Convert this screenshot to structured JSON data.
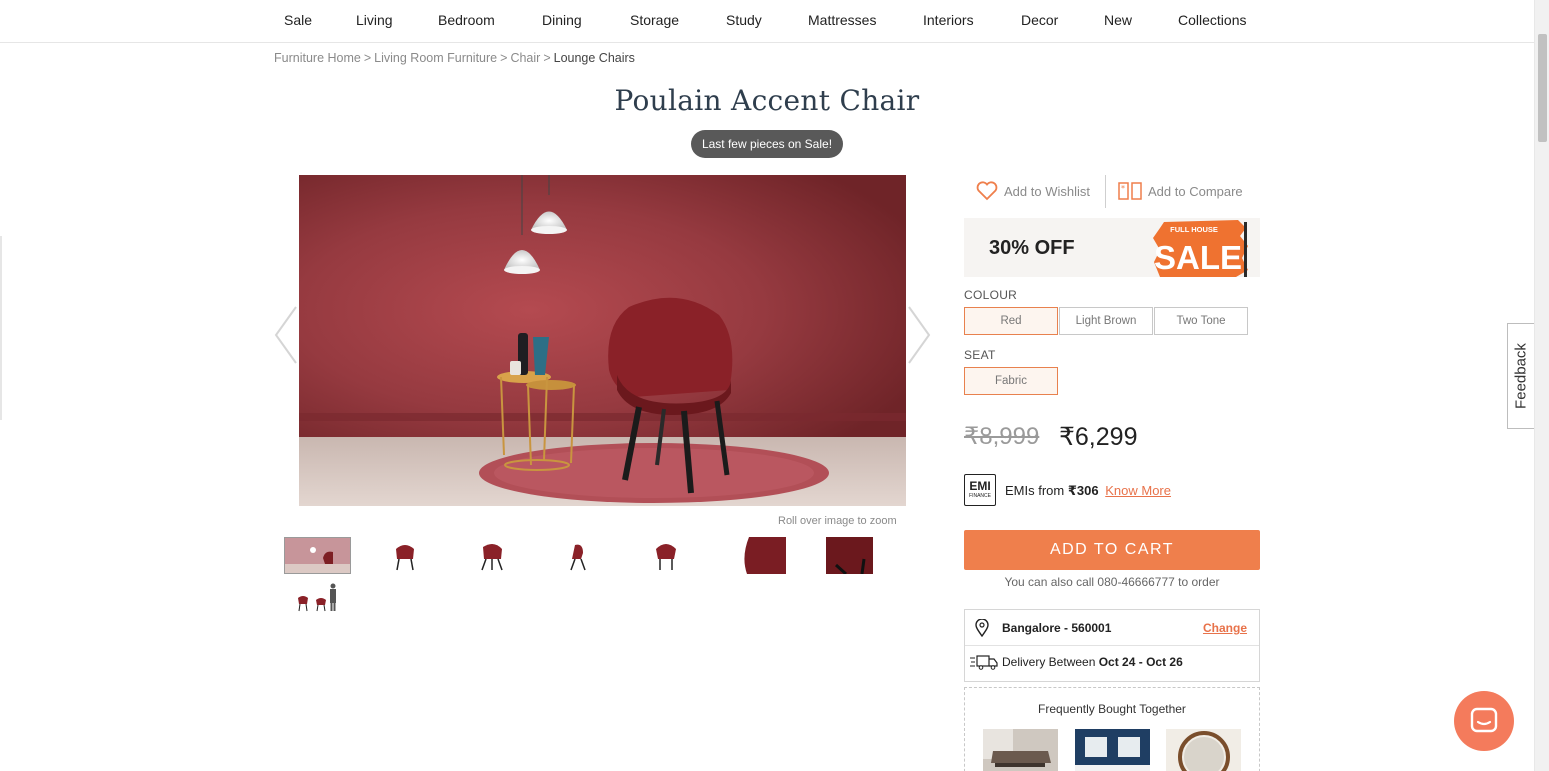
{
  "nav": {
    "items": [
      "Sale",
      "Living",
      "Bedroom",
      "Dining",
      "Storage",
      "Study",
      "Mattresses",
      "Interiors",
      "Decor",
      "New",
      "Collections"
    ]
  },
  "breadcrumb": {
    "items": [
      "Furniture Home",
      "Living Room Furniture",
      "Chair"
    ],
    "separator": ">",
    "current": "Lounge Chairs"
  },
  "product": {
    "title": "Poulain Accent Chair",
    "sale_tag": "Last few pieces on Sale!",
    "zoom_hint": "Roll over image to zoom"
  },
  "actions": {
    "wishlist": "Add to Wishlist",
    "compare": "Add to Compare"
  },
  "promo": {
    "discount": "30% OFF",
    "badge_line1": "FULL HOUSE",
    "badge_line2": "SALE"
  },
  "options": {
    "colour_label": "COLOUR",
    "colours": [
      "Red",
      "Light Brown",
      "Two Tone"
    ],
    "selected_colour": "Red",
    "seat_label": "SEAT",
    "seats": [
      "Fabric"
    ],
    "selected_seat": "Fabric"
  },
  "pricing": {
    "mrp": "₹8,999",
    "price": "₹6,299"
  },
  "emi": {
    "icon_big": "EMI",
    "icon_small": "FINANCE",
    "prefix": "EMIs from",
    "amount": "₹306",
    "link": "Know More"
  },
  "cart": {
    "button": "ADD TO CART",
    "call_text": "You can also call 080-46666777 to order"
  },
  "delivery": {
    "location": "Bangalore - 560001",
    "change": "Change",
    "prefix": "Delivery Between",
    "dates": "Oct 24 - Oct 26"
  },
  "fbt": {
    "title": "Frequently Bought Together"
  },
  "feedback": "Feedback",
  "colors": {
    "accent": "#ef7f4c",
    "link": "#e8724a",
    "hero_wall": "#8e3338",
    "chair": "#7d1f24",
    "title": "#2f3e4d"
  },
  "icons": {
    "wishlist": "heart-icon",
    "compare": "compare-icon",
    "location": "map-pin-icon",
    "delivery": "truck-icon",
    "chat": "chat-icon",
    "prev": "chevron-left-icon",
    "next": "chevron-right-icon"
  }
}
